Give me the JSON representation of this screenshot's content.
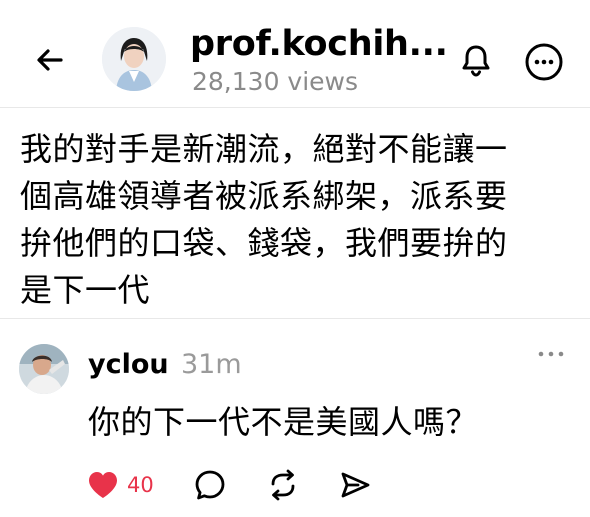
{
  "header": {
    "title": "prof.kochih...",
    "views": "28,130 views",
    "back_icon": "arrow-left-icon",
    "bell_icon": "bell-icon",
    "more_icon": "more-circle-icon"
  },
  "post": {
    "lines": [
      "我的對手是新潮流，絕對不能讓一",
      "個高雄領導者被派系綁架，派系要",
      "拚他們的口袋、錢袋，我們要拚的",
      "是下一代"
    ]
  },
  "reply": {
    "username": "yclou",
    "time": "31m",
    "text": "你的下一代不是美國人嗎？",
    "more_icon": "more-dots-icon"
  },
  "actions": {
    "like_count": "40",
    "like_icon": "heart-icon",
    "comment_icon": "comment-icon",
    "repost_icon": "repost-icon",
    "share_icon": "share-icon"
  },
  "colors": {
    "like": "#e8334a",
    "muted": "#8a8a8a",
    "divider": "#e8e8e8"
  }
}
